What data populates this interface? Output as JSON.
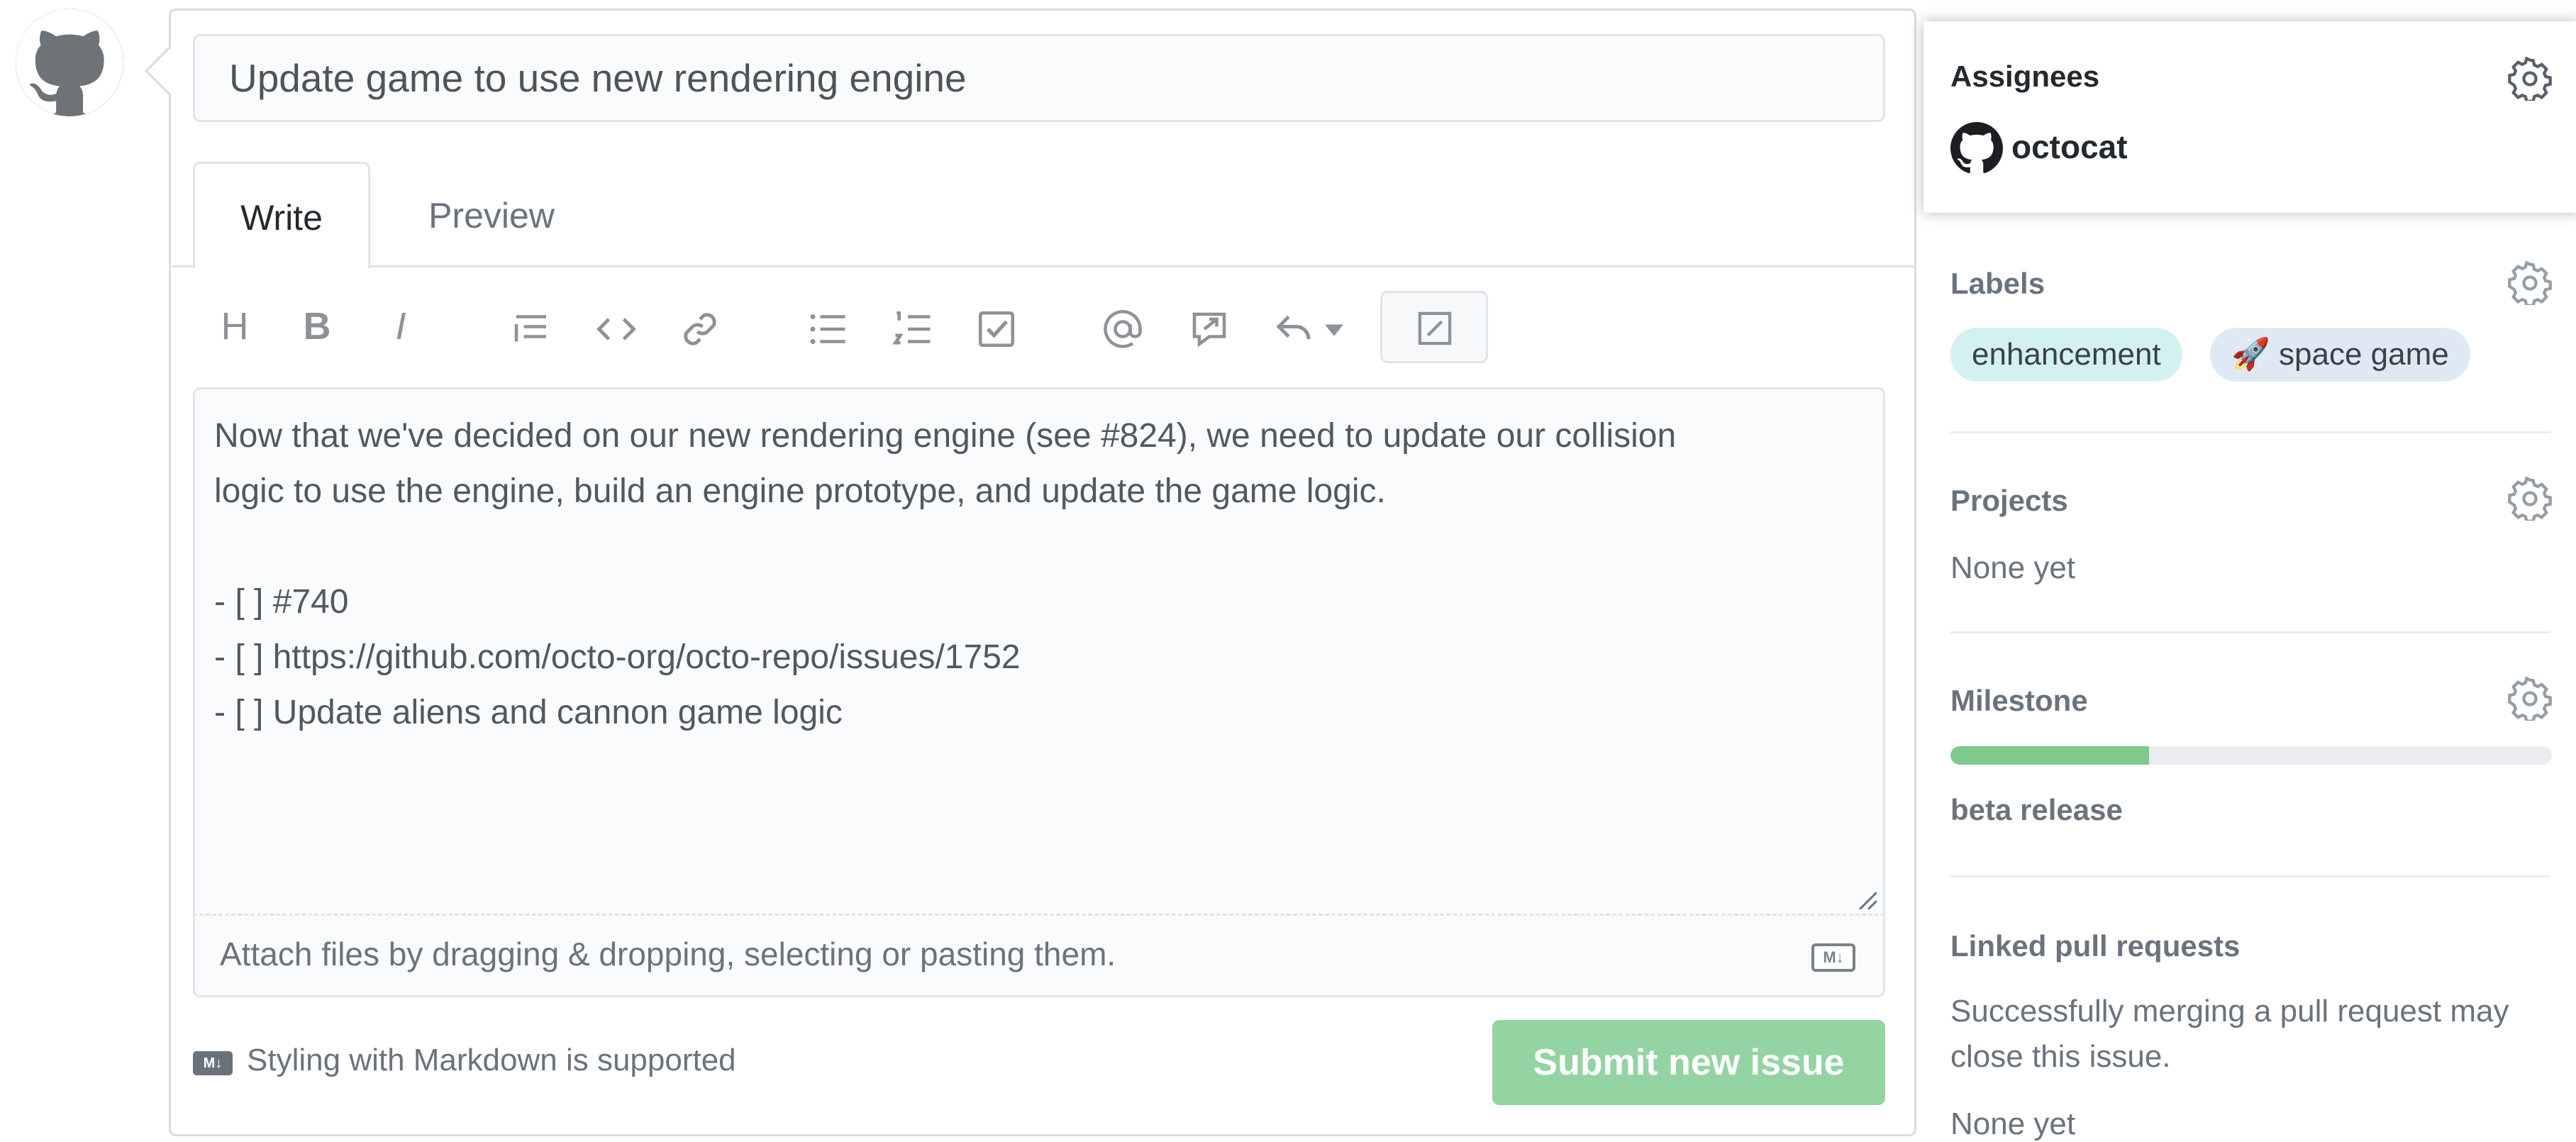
{
  "issue": {
    "title_value": "Update game to use new rendering engine"
  },
  "editor": {
    "tabs": [
      {
        "label": "Write",
        "active": true
      },
      {
        "label": "Preview",
        "active": false
      }
    ],
    "toolbar_icons": [
      "heading-icon",
      "bold-icon",
      "italic-icon",
      "quote-icon",
      "code-icon",
      "link-icon",
      "bulleted-list-icon",
      "numbered-list-icon",
      "task-list-icon",
      "mention-icon",
      "reference-icon",
      "saved-replies-icon",
      "fullscreen-icon"
    ],
    "toolbar_text": {
      "heading": "H",
      "bold": "B",
      "italic": "I"
    },
    "body_text": "Now that we've decided on our new rendering engine (see #824), we need to update our collision\nlogic to use the engine, build an engine prototype, and update the game logic.\n\n- [ ] #740\n- [ ] https://github.com/octo-org/octo-repo/issues/1752\n- [ ] Update aliens and cannon game logic",
    "attach_hint": "Attach files by dragging & dropping, selecting or pasting them.",
    "markdown_badge": "M↓",
    "markdown_note": "Styling with Markdown is supported",
    "submit_label": "Submit new issue"
  },
  "sidebar": {
    "assignees": {
      "heading": "Assignees",
      "users": [
        {
          "name": "octocat"
        }
      ]
    },
    "labels": {
      "heading": "Labels",
      "items": [
        {
          "name": "enhancement",
          "color": "#d4f1f1"
        },
        {
          "name": "🚀 space game",
          "color": "#dfe9f4"
        }
      ]
    },
    "projects": {
      "heading": "Projects",
      "value": "None yet"
    },
    "milestone": {
      "heading": "Milestone",
      "name": "beta release",
      "progress": 0.33
    },
    "linked_prs": {
      "heading": "Linked pull requests",
      "description": "Successfully merging a pull request may close this issue.",
      "value": "None yet"
    }
  },
  "colors": {
    "submit_button": "#94d3a2",
    "milestone_fill": "#7fc98d",
    "milestone_track": "#eaecef",
    "border": "#e1e4e8"
  }
}
